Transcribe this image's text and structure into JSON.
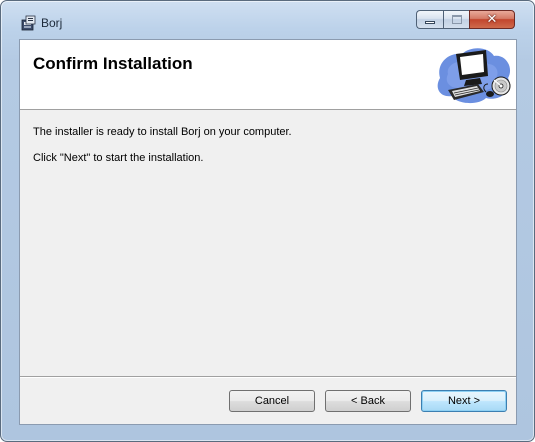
{
  "window": {
    "title": "Borj",
    "close_glyph": "✕"
  },
  "banner": {
    "title": "Confirm Installation",
    "art_icon": "computer-cd-clipart"
  },
  "content": {
    "line1": "The installer is ready to install Borj on your computer.",
    "line2": "Click \"Next\" to start the installation."
  },
  "buttons": {
    "cancel": "Cancel",
    "back": "< Back",
    "next": "Next >"
  },
  "icons": {
    "app": "installer-app-icon",
    "minimize": "minimize-icon",
    "maximize": "maximize-icon",
    "close": "close-icon"
  },
  "colors": {
    "frame": "#b4cae3",
    "client_bg": "#f0f0f0",
    "banner_bg": "#ffffff",
    "close_button": "#c2452d",
    "default_button_border": "#3c7fb1"
  }
}
